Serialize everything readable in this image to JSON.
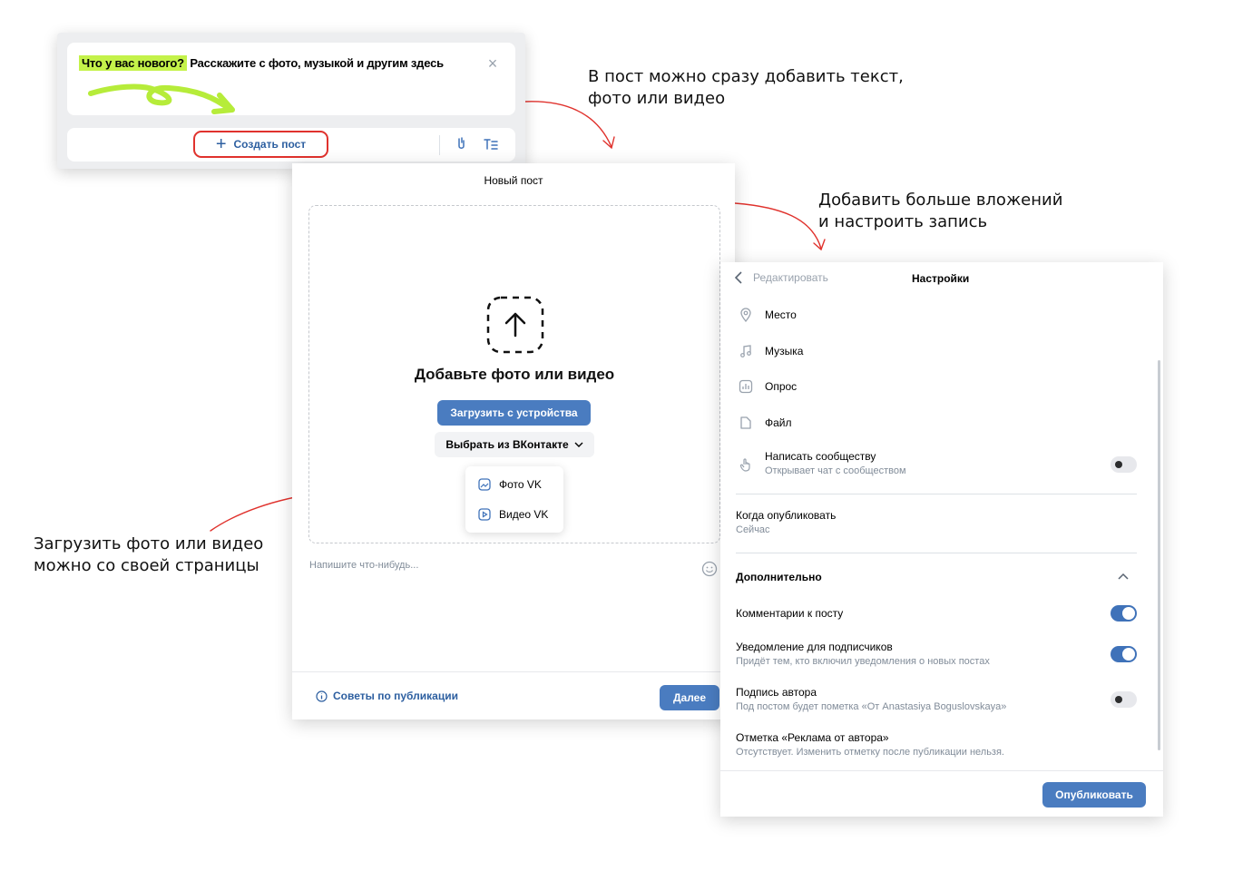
{
  "composer": {
    "prompt_highlight": "Что у вас нового?",
    "prompt_rest": " Расскажите с фото, музыкой и другим здесь",
    "create_post": "Создать пост"
  },
  "annotations": {
    "top_line1": "В пост можно сразу добавить текст,",
    "top_line2": "фото или видео",
    "right_line1": "Добавить больше вложений",
    "right_line2": "и настроить запись",
    "left_line1": "Загрузить фото или видео",
    "left_line2": "можно со своей страницы"
  },
  "dialog": {
    "title": "Новый пост",
    "heading": "Добавьте фото или видео",
    "upload_button": "Загрузить с устройства",
    "choose_button": "Выбрать из ВКонтакте",
    "menu": [
      "Фото VK",
      "Видео VK"
    ],
    "text_placeholder": "Напишите что-нибудь...",
    "tips": "Советы по публикации",
    "next": "Далее"
  },
  "settings": {
    "back": "Редактировать",
    "title": "Настройки",
    "attachments": [
      "Место",
      "Музыка",
      "Опрос",
      "Файл"
    ],
    "write_community": {
      "title": "Написать сообществу",
      "sub": "Открывает чат с сообществом"
    },
    "when_publish": {
      "title": "Когда опубликовать",
      "sub": "Сейчас"
    },
    "additional": "Дополнительно",
    "comments": "Комментарии к посту",
    "notification": {
      "title": "Уведомление для подписчиков",
      "sub": "Придёт тем, кто включил уведомления о новых постах"
    },
    "author_signature": {
      "title": "Подпись автора",
      "sub": "Под постом будет пометка «От Anastasiya Boguslovskaya»"
    },
    "ad_mark": {
      "title": "Отметка «Реклама от автора»",
      "sub": "Отсутствует. Изменить отметку после публикации нельзя."
    },
    "publish": "Опубликовать"
  },
  "colors": {
    "accent": "#4a7cc0",
    "highlight": "#c4f24a",
    "arrow": "#e0322d"
  }
}
